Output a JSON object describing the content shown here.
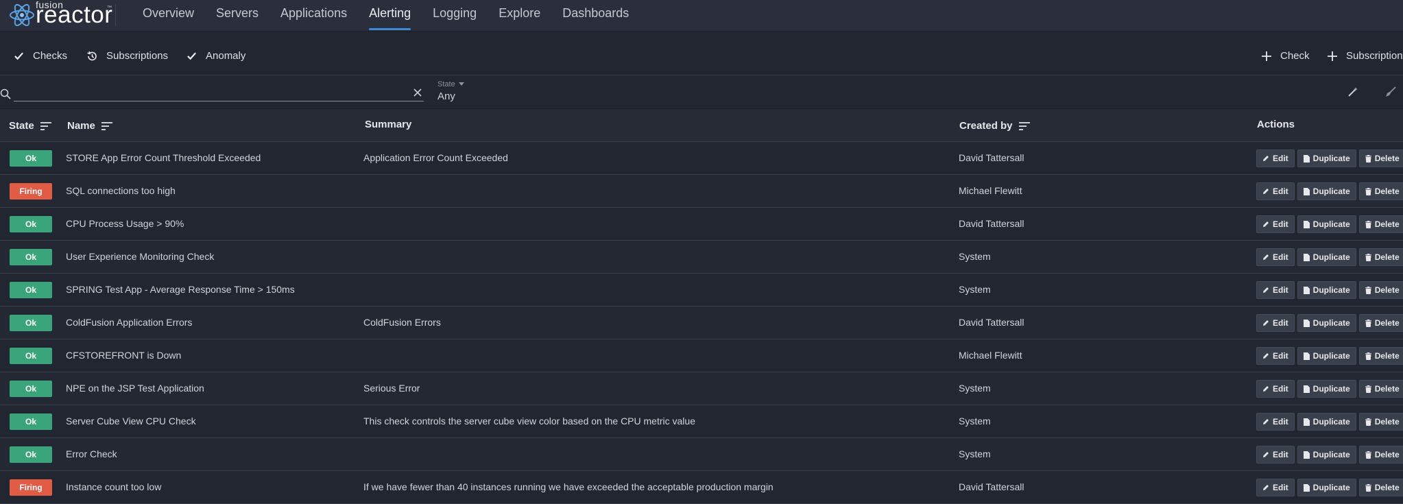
{
  "app": {
    "logo_top": "fusion",
    "logo_main": "reactor",
    "logo_tm": "™"
  },
  "nav": [
    {
      "label": "Overview",
      "active": false
    },
    {
      "label": "Servers",
      "active": false
    },
    {
      "label": "Applications",
      "active": false
    },
    {
      "label": "Alerting",
      "active": true
    },
    {
      "label": "Logging",
      "active": false
    },
    {
      "label": "Explore",
      "active": false
    },
    {
      "label": "Dashboards",
      "active": false
    }
  ],
  "tabs": {
    "checks": "Checks",
    "subscriptions": "Subscriptions",
    "anomaly": "Anomaly",
    "add_check": "Check",
    "add_subscription": "Subscription"
  },
  "filter": {
    "search_value": "",
    "search_placeholder": "",
    "state_label": "State",
    "state_value": "Any"
  },
  "table": {
    "headers": {
      "state": "State",
      "name": "Name",
      "summary": "Summary",
      "created_by": "Created by",
      "actions": "Actions"
    },
    "action_labels": {
      "edit": "Edit",
      "duplicate": "Duplicate",
      "delete": "Delete"
    },
    "rows": [
      {
        "state": "Ok",
        "name": "STORE App Error Count Threshold Exceeded",
        "summary": "Application Error Count Exceeded",
        "created_by": "David Tattersall"
      },
      {
        "state": "Firing",
        "name": "SQL connections too high",
        "summary": "",
        "created_by": "Michael Flewitt"
      },
      {
        "state": "Ok",
        "name": "CPU Process Usage > 90%",
        "summary": "",
        "created_by": "David Tattersall"
      },
      {
        "state": "Ok",
        "name": "User Experience Monitoring Check",
        "summary": "",
        "created_by": "System"
      },
      {
        "state": "Ok",
        "name": "SPRING Test App - Average Response Time > 150ms",
        "summary": "",
        "created_by": "System"
      },
      {
        "state": "Ok",
        "name": "ColdFusion Application Errors",
        "summary": "ColdFusion Errors",
        "created_by": "David Tattersall"
      },
      {
        "state": "Ok",
        "name": "CFSTOREFRONT is Down",
        "summary": "",
        "created_by": "Michael Flewitt"
      },
      {
        "state": "Ok",
        "name": "NPE on the JSP Test Application",
        "summary": "Serious Error",
        "created_by": "System"
      },
      {
        "state": "Ok",
        "name": "Server Cube View CPU Check",
        "summary": "This check controls the server cube view color based on the CPU metric value",
        "created_by": "System"
      },
      {
        "state": "Ok",
        "name": "Error Check",
        "summary": "",
        "created_by": "System"
      },
      {
        "state": "Firing",
        "name": "Instance count too low",
        "summary": "If we have fewer than 40 instances running we have exceeded the acceptable production margin",
        "created_by": "David Tattersall"
      }
    ]
  },
  "colors": {
    "ok": "#3aa57a",
    "firing": "#e25c45",
    "accent": "#3c8bd8"
  }
}
